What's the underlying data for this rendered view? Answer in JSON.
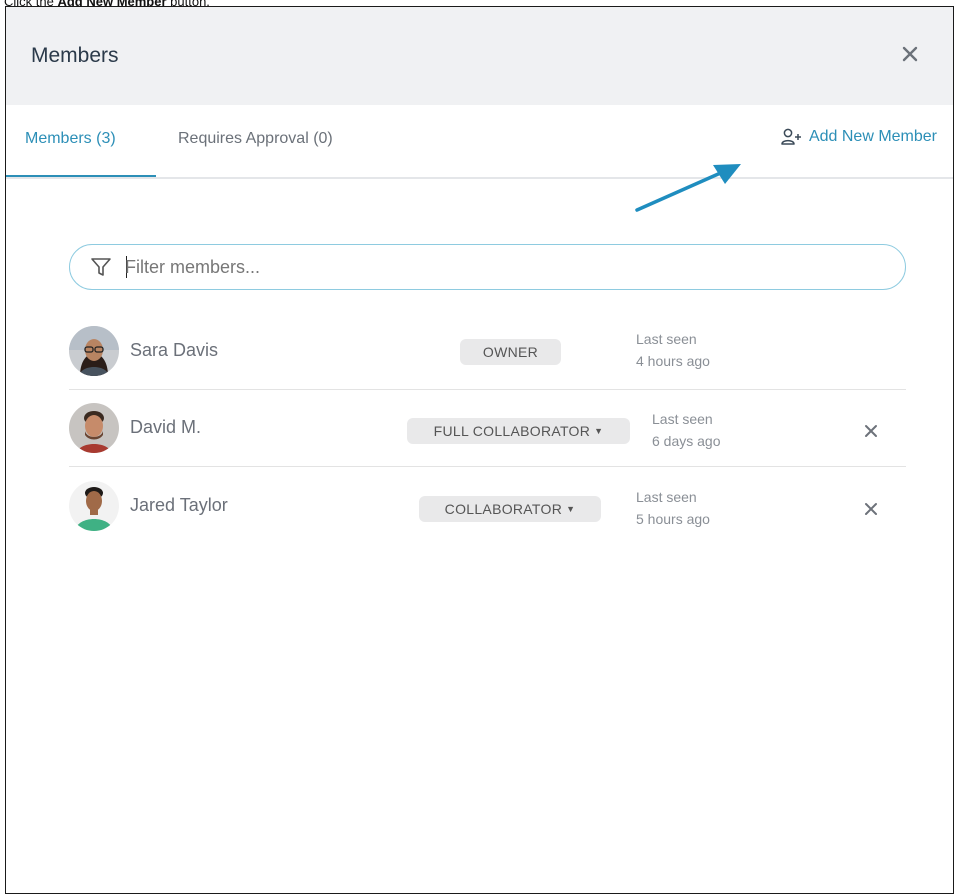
{
  "instruction": {
    "prefix": "Click the ",
    "bold": "Add New Member",
    "suffix": " button."
  },
  "modal": {
    "title": "Members",
    "close_icon": "close-icon"
  },
  "tabs": [
    {
      "label": "Members (3)",
      "active": true
    },
    {
      "label": "Requires Approval (0)",
      "active": false
    }
  ],
  "add_member": {
    "label": "Add New Member",
    "icon": "add-user-icon"
  },
  "filter": {
    "placeholder": "Filter members...",
    "value": "",
    "icon": "filter-icon"
  },
  "members": [
    {
      "name": "Sara Davis",
      "role": "OWNER",
      "role_dropdown": false,
      "last_seen_label": "Last seen",
      "last_seen": "4 hours ago",
      "removable": false
    },
    {
      "name": "David M.",
      "role": "FULL COLLABORATOR",
      "role_dropdown": true,
      "last_seen_label": "Last seen",
      "last_seen": "6 days ago",
      "removable": true
    },
    {
      "name": "Jared Taylor",
      "role": "COLLABORATOR",
      "role_dropdown": true,
      "last_seen_label": "Last seen",
      "last_seen": "5 hours ago",
      "removable": true
    }
  ],
  "colors": {
    "accent": "#2c8fb7",
    "header_bg": "#f0f1f3",
    "badge_bg": "#e9e9ea",
    "annotation_arrow": "#1f8dbf"
  }
}
